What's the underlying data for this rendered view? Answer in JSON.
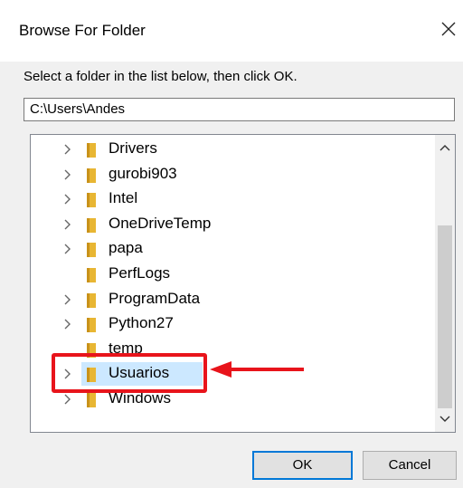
{
  "dialog": {
    "title": "Browse For Folder",
    "instruction": "Select a folder in the list below, then click OK.",
    "path_value": "C:\\Users\\Andes"
  },
  "tree": {
    "items": [
      {
        "label": "Drivers",
        "expandable": true
      },
      {
        "label": "gurobi903",
        "expandable": true
      },
      {
        "label": "Intel",
        "expandable": true
      },
      {
        "label": "OneDriveTemp",
        "expandable": true
      },
      {
        "label": "papa",
        "expandable": true
      },
      {
        "label": "PerfLogs",
        "expandable": false
      },
      {
        "label": "ProgramData",
        "expandable": true
      },
      {
        "label": "Python27",
        "expandable": true
      },
      {
        "label": "temp",
        "expandable": false
      },
      {
        "label": "Usuarios",
        "expandable": true,
        "selected": true
      },
      {
        "label": "Windows",
        "expandable": true
      }
    ]
  },
  "buttons": {
    "ok_label": "OK",
    "cancel_label": "Cancel"
  },
  "colors": {
    "folder": "#e8b633",
    "selection": "#cce8ff",
    "annotation": "#e8141b",
    "ok_border": "#0078d7"
  },
  "icons": {
    "close": "close-icon",
    "folder": "folder-icon",
    "chevron": "chevron-right-icon",
    "scroll_up": "chevron-up-icon",
    "scroll_down": "chevron-down-icon"
  }
}
